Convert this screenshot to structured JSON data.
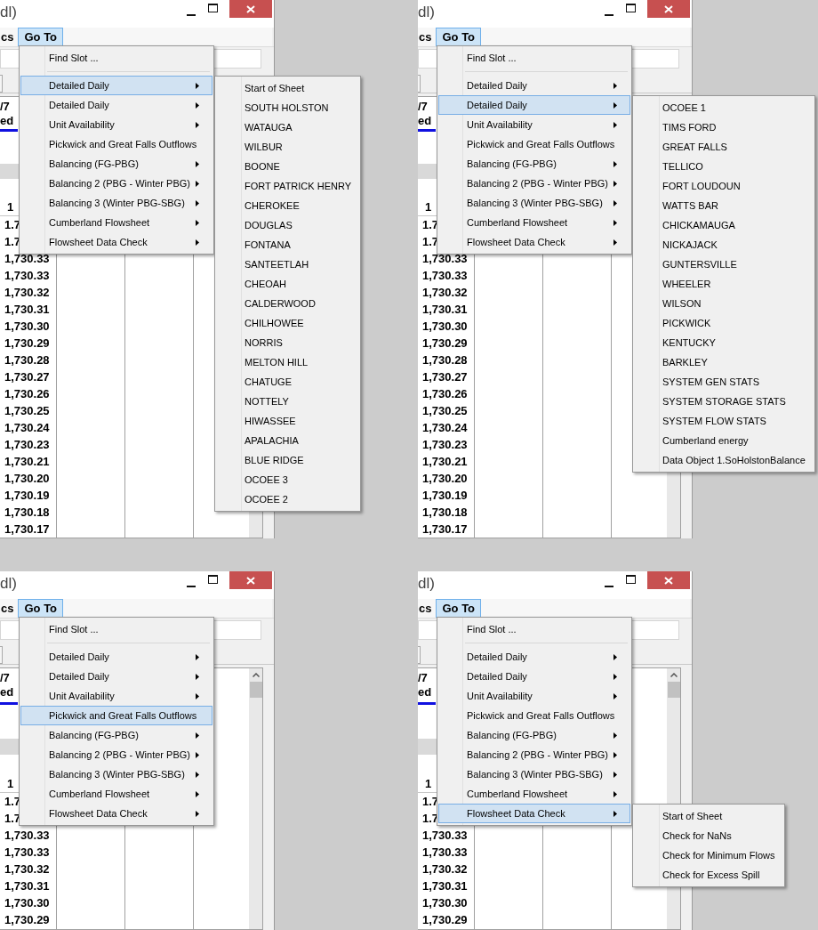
{
  "panels": [
    {
      "window": {
        "title": "dl)"
      },
      "menubar": [
        {
          "label": "cs",
          "selected": false
        },
        {
          "label": "Go To",
          "selected": true
        }
      ],
      "table": {
        "header": [
          "/7",
          "ed"
        ],
        "column_header": "1",
        "values": [
          "1.7",
          "1.7",
          "1,730.33",
          "1,730.33",
          "1,730.32",
          "1,730.31",
          "1,730.30",
          "1,730.29",
          "1,730.28",
          "1,730.27",
          "1,730.26",
          "1,730.25",
          "1,730.24",
          "1,730.23",
          "1,730.21",
          "1,730.20",
          "1,730.19",
          "1,730.18",
          "1,730.17"
        ]
      },
      "menu": {
        "items": [
          {
            "kind": "command",
            "label": "Find Slot ...",
            "selected": false
          },
          {
            "kind": "separator"
          },
          {
            "kind": "submenu",
            "label": "Detailed Daily",
            "selected": true
          },
          {
            "kind": "submenu",
            "label": "Detailed Daily",
            "selected": false
          },
          {
            "kind": "submenu",
            "label": "Unit Availability",
            "selected": false
          },
          {
            "kind": "command",
            "label": "Pickwick and Great Falls Outflows",
            "selected": false
          },
          {
            "kind": "submenu",
            "label": "Balancing (FG-PBG)",
            "selected": false
          },
          {
            "kind": "submenu",
            "label": "Balancing 2 (PBG - Winter PBG)",
            "selected": false
          },
          {
            "kind": "submenu",
            "label": "Balancing 3 (Winter PBG-SBG)",
            "selected": false
          },
          {
            "kind": "submenu",
            "label": "Cumberland Flowsheet",
            "selected": false
          },
          {
            "kind": "submenu",
            "label": "Flowsheet Data Check",
            "selected": false
          }
        ]
      },
      "submenu": {
        "items": [
          "Start of Sheet",
          "SOUTH HOLSTON",
          "WATAUGA",
          "WILBUR",
          "BOONE",
          "FORT PATRICK HENRY",
          "CHEROKEE",
          "DOUGLAS",
          "FONTANA",
          "SANTEETLAH",
          "CHEOAH",
          "CALDERWOOD",
          "CHILHOWEE",
          "NORRIS",
          "MELTON HILL",
          "CHATUGE",
          "NOTTELY",
          "HIWASSEE",
          "APALACHIA",
          "BLUE RIDGE",
          "OCOEE 3",
          "OCOEE 2"
        ]
      }
    },
    {
      "window": {
        "title": "dl)"
      },
      "menubar": [
        {
          "label": "cs",
          "selected": false
        },
        {
          "label": "Go To",
          "selected": true
        }
      ],
      "table": {
        "header": [
          "/7",
          "ed"
        ],
        "column_header": "1",
        "values": [
          "1.7",
          "1.7",
          "1,730.33",
          "1,730.33",
          "1,730.32",
          "1,730.31",
          "1,730.30",
          "1,730.29",
          "1,730.28",
          "1,730.27",
          "1,730.26",
          "1,730.25",
          "1,730.24",
          "1,730.23",
          "1,730.21",
          "1,730.20",
          "1,730.19",
          "1,730.18",
          "1,730.17"
        ]
      },
      "menu": {
        "items": [
          {
            "kind": "command",
            "label": "Find Slot ...",
            "selected": false
          },
          {
            "kind": "separator"
          },
          {
            "kind": "submenu",
            "label": "Detailed Daily",
            "selected": false
          },
          {
            "kind": "submenu",
            "label": "Detailed Daily",
            "selected": true
          },
          {
            "kind": "submenu",
            "label": "Unit Availability",
            "selected": false
          },
          {
            "kind": "command",
            "label": "Pickwick and Great Falls Outflows",
            "selected": false
          },
          {
            "kind": "submenu",
            "label": "Balancing (FG-PBG)",
            "selected": false
          },
          {
            "kind": "submenu",
            "label": "Balancing 2 (PBG - Winter PBG)",
            "selected": false
          },
          {
            "kind": "submenu",
            "label": "Balancing 3 (Winter PBG-SBG)",
            "selected": false
          },
          {
            "kind": "submenu",
            "label": "Cumberland Flowsheet",
            "selected": false
          },
          {
            "kind": "submenu",
            "label": "Flowsheet Data Check",
            "selected": false
          }
        ]
      },
      "submenu": {
        "items": [
          "OCOEE 1",
          "TIMS FORD",
          "GREAT FALLS",
          "TELLICO",
          "FORT LOUDOUN",
          "WATTS BAR",
          "CHICKAMAUGA",
          "NICKAJACK",
          "GUNTERSVILLE",
          "WHEELER",
          "WILSON",
          "PICKWICK",
          "KENTUCKY",
          "BARKLEY",
          "SYSTEM GEN STATS",
          "SYSTEM STORAGE STATS",
          "SYSTEM FLOW STATS",
          "Cumberland energy",
          "Data Object 1.SoHolstonBalance"
        ]
      }
    },
    {
      "window": {
        "title": "dl)"
      },
      "menubar": [
        {
          "label": "cs",
          "selected": false
        },
        {
          "label": "Go To",
          "selected": true
        }
      ],
      "table": {
        "header": [
          "/7",
          "ed"
        ],
        "column_header": "1",
        "values": [
          "1.7",
          "1.7",
          "1,730.33",
          "1,730.33",
          "1,730.32",
          "1,730.31",
          "1,730.30",
          "1,730.29"
        ]
      },
      "menu": {
        "items": [
          {
            "kind": "command",
            "label": "Find Slot ...",
            "selected": false
          },
          {
            "kind": "separator"
          },
          {
            "kind": "submenu",
            "label": "Detailed Daily",
            "selected": false
          },
          {
            "kind": "submenu",
            "label": "Detailed Daily",
            "selected": false
          },
          {
            "kind": "submenu",
            "label": "Unit Availability",
            "selected": false
          },
          {
            "kind": "command",
            "label": "Pickwick and Great Falls Outflows",
            "selected": true
          },
          {
            "kind": "submenu",
            "label": "Balancing (FG-PBG)",
            "selected": false
          },
          {
            "kind": "submenu",
            "label": "Balancing 2 (PBG - Winter PBG)",
            "selected": false
          },
          {
            "kind": "submenu",
            "label": "Balancing 3 (Winter PBG-SBG)",
            "selected": false
          },
          {
            "kind": "submenu",
            "label": "Cumberland Flowsheet",
            "selected": false
          },
          {
            "kind": "submenu",
            "label": "Flowsheet Data Check",
            "selected": false
          }
        ]
      }
    },
    {
      "window": {
        "title": "dl)"
      },
      "menubar": [
        {
          "label": "cs",
          "selected": false
        },
        {
          "label": "Go To",
          "selected": true
        }
      ],
      "table": {
        "header": [
          "/7",
          "ed"
        ],
        "column_header": "1",
        "values": [
          "1.7",
          "1.7",
          "1,730.33",
          "1,730.33",
          "1,730.32",
          "1,730.31",
          "1,730.30",
          "1,730.29"
        ]
      },
      "menu": {
        "items": [
          {
            "kind": "command",
            "label": "Find Slot ...",
            "selected": false
          },
          {
            "kind": "separator"
          },
          {
            "kind": "submenu",
            "label": "Detailed Daily",
            "selected": false
          },
          {
            "kind": "submenu",
            "label": "Detailed Daily",
            "selected": false
          },
          {
            "kind": "submenu",
            "label": "Unit Availability",
            "selected": false
          },
          {
            "kind": "command",
            "label": "Pickwick and Great Falls Outflows",
            "selected": false
          },
          {
            "kind": "submenu",
            "label": "Balancing (FG-PBG)",
            "selected": false
          },
          {
            "kind": "submenu",
            "label": "Balancing 2 (PBG - Winter PBG)",
            "selected": false
          },
          {
            "kind": "submenu",
            "label": "Balancing 3 (Winter PBG-SBG)",
            "selected": false
          },
          {
            "kind": "submenu",
            "label": "Cumberland Flowsheet",
            "selected": false
          },
          {
            "kind": "submenu",
            "label": "Flowsheet Data Check",
            "selected": true
          }
        ]
      },
      "submenu": {
        "items": [
          "Start of Sheet",
          "Check for NaNs",
          "Check for Minimum Flows",
          "Check for Excess Spill"
        ]
      }
    }
  ]
}
